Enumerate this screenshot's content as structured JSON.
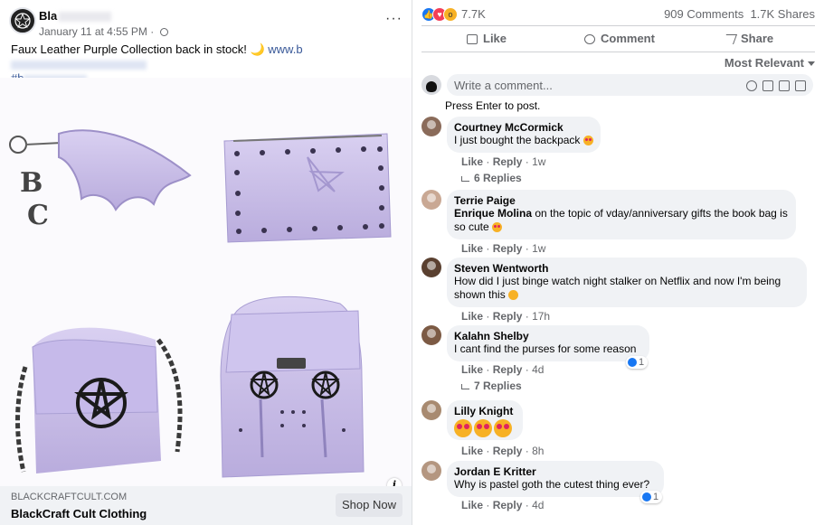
{
  "post": {
    "page_name": "Bla",
    "timestamp": "January 11 at 4:55 PM",
    "time_sep": "·",
    "more_label": "···",
    "text": "Faux Leather Purple Collection back in stock! 🌙",
    "link_prefix": "www.b",
    "hashtag_prefix": "#b",
    "image_alt": "Purple faux leather bags and accessories",
    "link_preview": {
      "domain": "BLACKCRAFTCULT.COM",
      "title": "BlackCraft Cult Clothing",
      "cta": "Shop Now"
    },
    "info_label": "i"
  },
  "stats": {
    "reactions_count": "7.7K",
    "comments": "909 Comments",
    "shares": "1.7K Shares"
  },
  "actions": {
    "like": "Like",
    "comment": "Comment",
    "share": "Share"
  },
  "sort_label": "Most Relevant",
  "compose": {
    "placeholder": "Write a comment...",
    "hint": "Press Enter to post."
  },
  "comments": [
    {
      "name": "Courtney McCormick",
      "text": "I just bought the backpack",
      "like": "Like",
      "reply": "Reply",
      "time": "1w",
      "replies": "6 Replies"
    },
    {
      "name": "Terrie Paige",
      "mention": "Enrique Molina",
      "text": " on the topic of vday/anniversary gifts the book bag is so cute",
      "like": "Like",
      "reply": "Reply",
      "time": "1w"
    },
    {
      "name": "Steven Wentworth",
      "text": "How did I just binge watch night stalker on Netflix and now I'm being shown this",
      "like": "Like",
      "reply": "Reply",
      "time": "17h"
    },
    {
      "name": "Kalahn Shelby",
      "text": "I cant find the purses for some reason",
      "like": "Like",
      "reply": "Reply",
      "time": "4d",
      "reaction_count": "1",
      "replies": "7 Replies"
    },
    {
      "name": "Lilly Knight",
      "like": "Like",
      "reply": "Reply",
      "time": "8h"
    },
    {
      "name": "Jordan E Kritter",
      "text": "Why is pastel goth the cutest thing ever?",
      "like": "Like",
      "reply": "Reply",
      "time": "4d",
      "reaction_count": "1"
    }
  ],
  "sep": "·",
  "colors": {
    "accent": "#1877f2",
    "product": "#c9bde8",
    "text_secondary": "#65676b"
  }
}
